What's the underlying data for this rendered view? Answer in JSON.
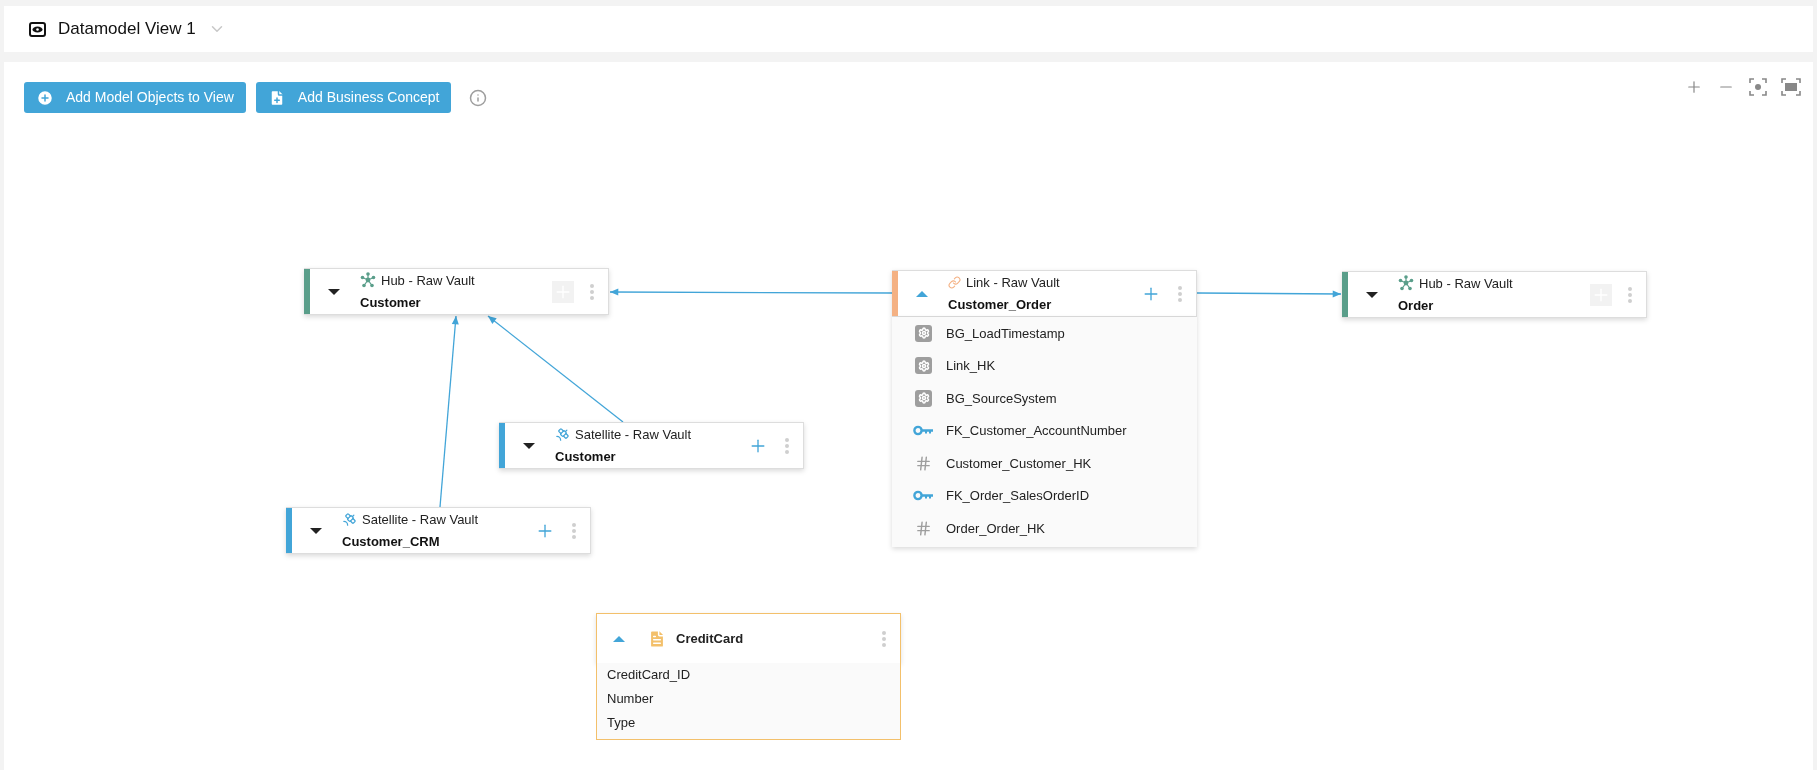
{
  "header": {
    "title": "Datamodel View 1"
  },
  "toolbar": {
    "buttons": [
      {
        "kind": "add-objects",
        "label": "Add Model Objects to View"
      },
      {
        "kind": "add-concept",
        "label": "Add Business Concept"
      }
    ]
  },
  "nodes": [
    {
      "kind": "hub",
      "type": "Hub - Raw Vault",
      "name": "Customer",
      "color": "#5a9e8a",
      "expanded": false,
      "add_disabled": true
    },
    {
      "kind": "satellite",
      "type": "Satellite - Raw Vault",
      "name": "Customer",
      "color": "#42a5d8",
      "expanded": false,
      "add_disabled": false
    },
    {
      "kind": "satellite",
      "type": "Satellite - Raw Vault",
      "name": "Customer_CRM",
      "color": "#42a5d8",
      "expanded": false,
      "add_disabled": false
    },
    {
      "kind": "link",
      "type": "Link - Raw Vault",
      "name": "Customer_Order",
      "color": "#f4b183",
      "expanded": true,
      "add_disabled": false,
      "attributes": [
        {
          "kind": "system",
          "name": "BG_LoadTimestamp"
        },
        {
          "kind": "system",
          "name": "Link_HK"
        },
        {
          "kind": "system",
          "name": "BG_SourceSystem"
        },
        {
          "kind": "key",
          "name": "FK_Customer_AccountNumber"
        },
        {
          "kind": "hash",
          "name": "Customer_Customer_HK"
        },
        {
          "kind": "key",
          "name": "FK_Order_SalesOrderID"
        },
        {
          "kind": "hash",
          "name": "Order_Order_HK"
        }
      ]
    },
    {
      "kind": "hub",
      "type": "Hub - Raw Vault",
      "name": "Order",
      "color": "#5a9e8a",
      "expanded": false,
      "add_disabled": true
    },
    {
      "kind": "entity",
      "name": "CreditCard",
      "expanded": true,
      "attributes": [
        {
          "name": "CreditCard_ID"
        },
        {
          "name": "Number"
        },
        {
          "name": "Type"
        }
      ]
    }
  ]
}
